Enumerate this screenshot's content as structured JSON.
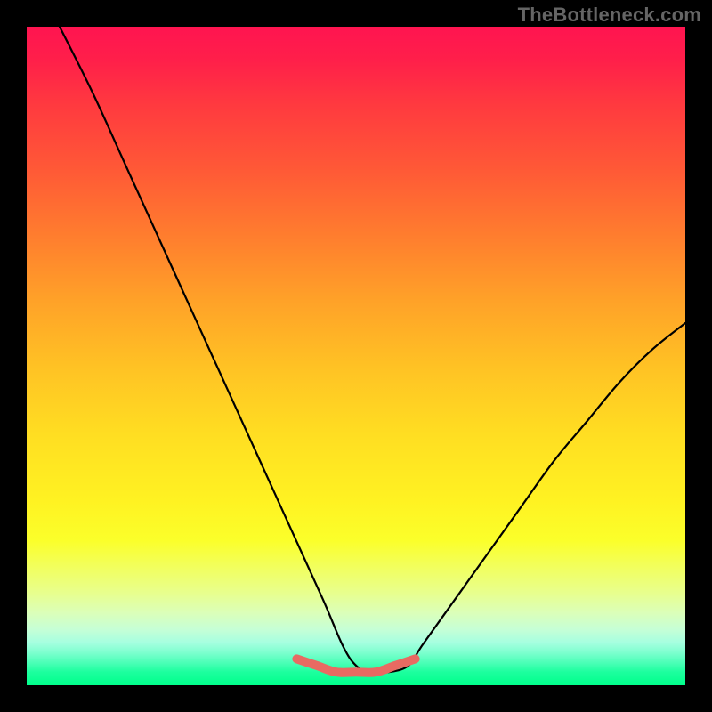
{
  "watermark": "TheBottleneck.com",
  "chart_data": {
    "type": "line",
    "title": "",
    "xlabel": "",
    "ylabel": "",
    "xlim": [
      0,
      100
    ],
    "ylim": [
      0,
      100
    ],
    "grid": false,
    "legend": false,
    "series": [
      {
        "name": "curve",
        "x": [
          5,
          10,
          15,
          20,
          25,
          30,
          35,
          40,
          45,
          48,
          50,
          52,
          55,
          58,
          60,
          65,
          70,
          75,
          80,
          85,
          90,
          95,
          100
        ],
        "values": [
          100,
          90,
          79,
          68,
          57,
          46,
          35,
          24,
          13,
          6,
          3,
          2,
          2,
          3,
          6,
          13,
          20,
          27,
          34,
          40,
          46,
          51,
          55
        ]
      },
      {
        "name": "bottom-band",
        "x": [
          41,
          44,
          47,
          50,
          53,
          56,
          59
        ],
        "values": [
          4,
          3,
          2,
          2,
          2,
          3,
          4
        ]
      }
    ],
    "gradient_stops": [
      {
        "pos": 0,
        "color": "#ff1450"
      },
      {
        "pos": 0.32,
        "color": "#ff7e2e"
      },
      {
        "pos": 0.62,
        "color": "#ffde22"
      },
      {
        "pos": 0.86,
        "color": "#e8ff8e"
      },
      {
        "pos": 1.0,
        "color": "#00ff8b"
      }
    ]
  }
}
